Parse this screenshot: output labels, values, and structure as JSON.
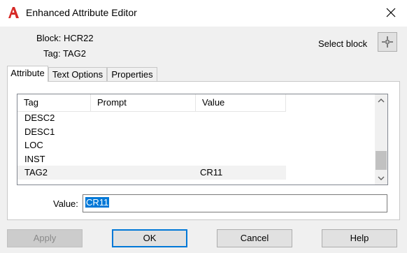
{
  "window": {
    "title": "Enhanced Attribute Editor",
    "app_icon": "autocad-a-icon"
  },
  "info": {
    "block": "Block: HCR22",
    "tag": "Tag: TAG2"
  },
  "select_block": {
    "label": "Select block",
    "icon": "pick-point-icon"
  },
  "tabs": [
    {
      "label": "Attribute",
      "active": true
    },
    {
      "label": "Text Options",
      "active": false
    },
    {
      "label": "Properties",
      "active": false
    }
  ],
  "list": {
    "columns": [
      "Tag",
      "Prompt",
      "Value"
    ],
    "rows": [
      {
        "tag": "DESC2",
        "prompt": "",
        "value": ""
      },
      {
        "tag": "DESC1",
        "prompt": "",
        "value": ""
      },
      {
        "tag": "LOC",
        "prompt": "",
        "value": ""
      },
      {
        "tag": "INST",
        "prompt": "",
        "value": ""
      },
      {
        "tag": "TAG2",
        "prompt": "",
        "value": "CR11",
        "selected": true
      }
    ]
  },
  "value_field": {
    "label": "Value:",
    "value": "CR11"
  },
  "buttons": {
    "apply": "Apply",
    "ok": "OK",
    "cancel": "Cancel",
    "help": "Help"
  }
}
